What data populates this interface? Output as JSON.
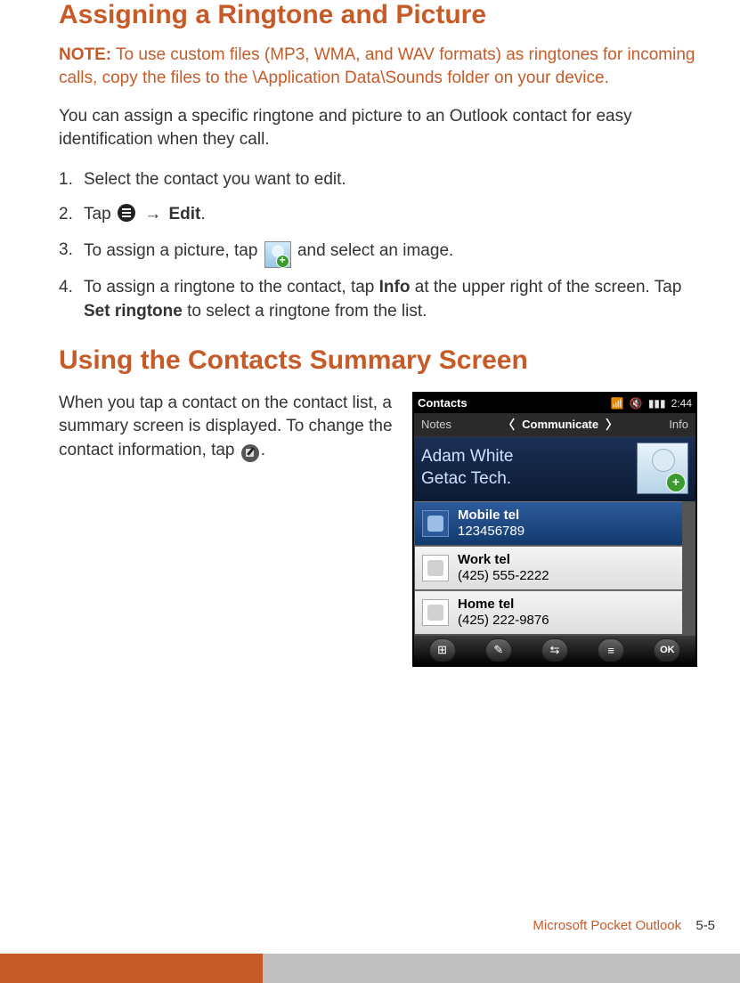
{
  "heading1": "Assigning a Ringtone and Picture",
  "note_label": "NOTE:",
  "note_text": " To use custom files (MP3, WMA, and WAV formats) as ringtones for incoming calls, copy the files to the \\Application Data\\Sounds folder on your device.",
  "intro": "You can assign a specific ringtone and picture to an Outlook contact for easy identification when they call.",
  "steps": {
    "s1": "Select the contact you want to edit.",
    "s2a": "Tap ",
    "s2b": " Edit",
    "s2c": ".",
    "s3a": "To assign a picture, tap ",
    "s3b": " and select an image.",
    "s4a": "To assign a ringtone to the contact, tap ",
    "s4b": "Info",
    "s4c": " at the upper right of the screen. Tap ",
    "s4d": "Set ringtone",
    "s4e": " to select a ringtone from the list."
  },
  "heading2": "Using the Contacts Summary Screen",
  "summary_a": "When you tap a contact on the contact list, a summary screen is displayed. To change the contact information, tap ",
  "summary_b": ".",
  "phone": {
    "title": "Contacts",
    "time": "2:44",
    "tab_left": "Notes",
    "tab_center": "Communicate",
    "tab_right": "Info",
    "name_line1": "Adam White",
    "name_line2": "Getac Tech.",
    "rows": [
      {
        "l1": "Mobile tel",
        "l2": "123456789"
      },
      {
        "l1": "Work tel",
        "l2": "(425) 555-2222"
      },
      {
        "l1": "Home tel",
        "l2": "(425) 222-9876"
      }
    ],
    "ok": "OK"
  },
  "footer_title": "Microsoft Pocket Outlook",
  "footer_page": "5-5"
}
